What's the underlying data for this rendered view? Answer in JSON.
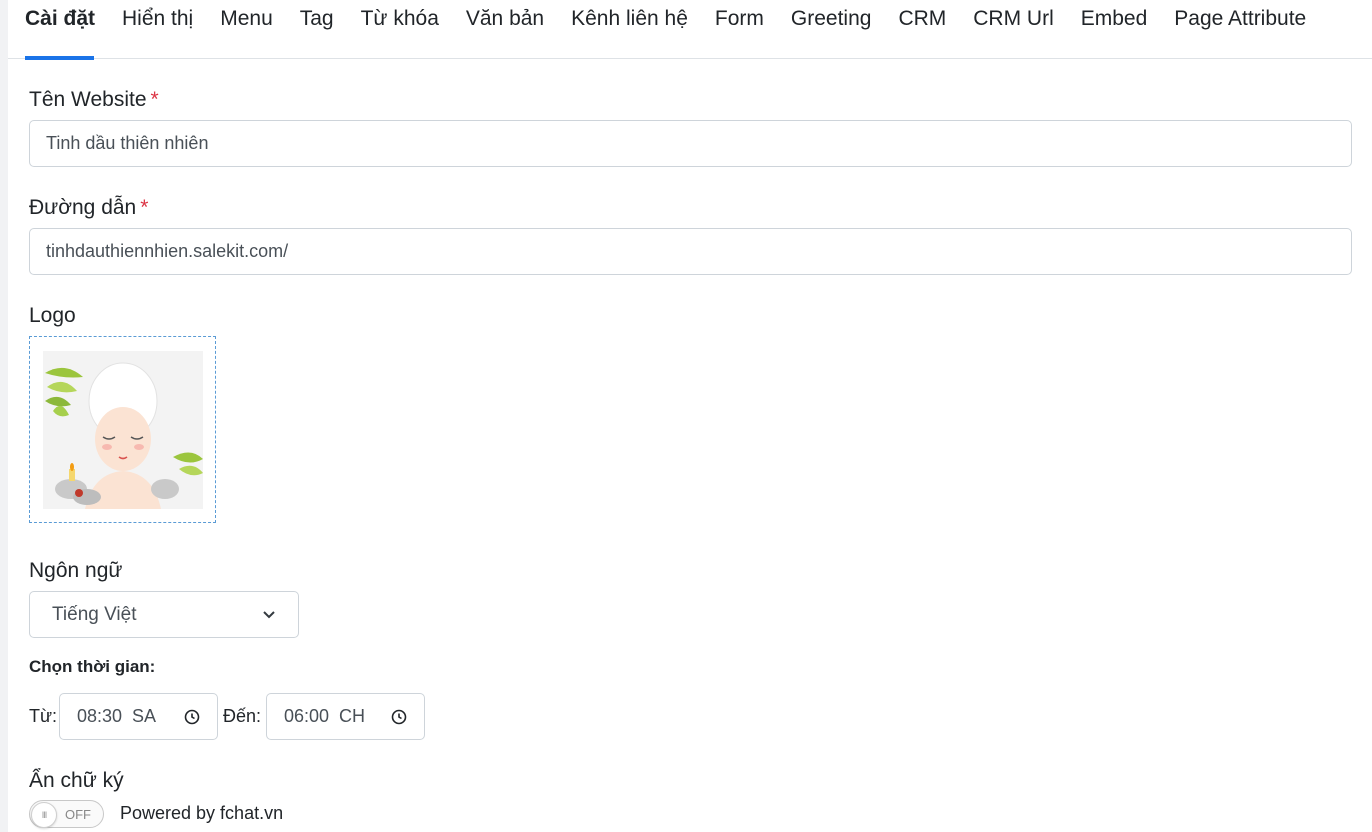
{
  "tabs": [
    {
      "label": "Cài đặt",
      "active": true
    },
    {
      "label": "Hiển thị"
    },
    {
      "label": "Menu"
    },
    {
      "label": "Tag"
    },
    {
      "label": "Từ khóa"
    },
    {
      "label": "Văn bản"
    },
    {
      "label": "Kênh liên hệ"
    },
    {
      "label": "Form"
    },
    {
      "label": "Greeting"
    },
    {
      "label": "CRM"
    },
    {
      "label": "CRM Url"
    },
    {
      "label": "Embed"
    },
    {
      "label": "Page Attribute"
    }
  ],
  "form": {
    "website_name": {
      "label": "Tên Website",
      "required_mark": "*",
      "value": "Tinh dầu thiên nhiên"
    },
    "path": {
      "label": "Đường dẫn",
      "required_mark": "*",
      "value": "tinhdauthiennhien.salekit.com/"
    },
    "logo": {
      "label": "Logo"
    },
    "language": {
      "label": "Ngôn ngữ",
      "selected": "Tiếng Việt"
    },
    "time": {
      "label": "Chọn thời gian:",
      "from_label": "Từ:",
      "from_value": "08:30  SA",
      "to_label": "Đến:",
      "to_value": "06:00  CH"
    },
    "signature": {
      "label": "Ẩn chữ ký",
      "toggle_state": "OFF",
      "knob_glyph": "III",
      "text": "Powered by fchat.vn"
    }
  },
  "colors": {
    "accent": "#1a73e8",
    "required": "#dc3545",
    "logo_border": "#5a9bd5"
  }
}
